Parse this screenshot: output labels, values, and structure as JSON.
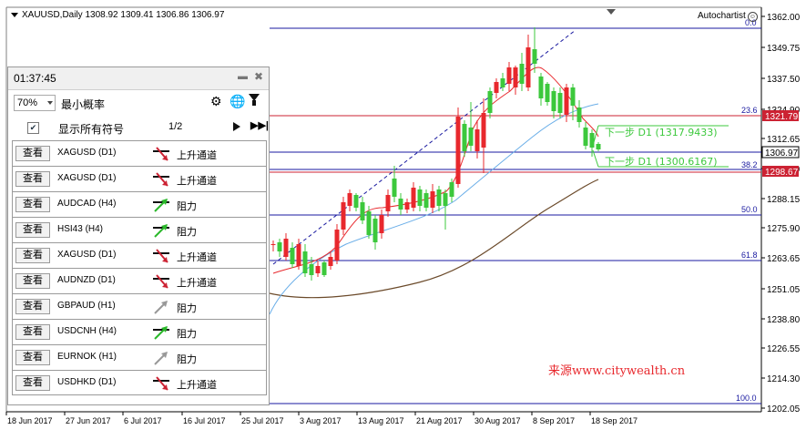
{
  "chart": {
    "symbol_info": "XAUUSD,Daily  1308.92 1309.41 1306.86 1306.97",
    "brand": "Autochartist",
    "watermark": "来源www.citywealth.cn",
    "price_labels": [
      "1362.00",
      "1349.75",
      "1337.50",
      "1324.90",
      "1312.65",
      "1300.40",
      "1288.15",
      "1275.90",
      "1263.65",
      "1251.05",
      "1238.80",
      "1226.55",
      "1214.30",
      "1202.05"
    ],
    "date_labels": [
      "18 Jun 2017",
      "27 Jun 2017",
      "6 Jul 2017",
      "16 Jul 2017",
      "25 Jul 2017",
      "3 Aug 2017",
      "13 Aug 2017",
      "21 Aug 2017",
      "30 Aug 2017",
      "8 Sep 2017",
      "18 Sep 2017"
    ],
    "current_price": "1306.97",
    "level_1321": "1321.79",
    "level_1298": "1298.67",
    "fib_labels": [
      "0.0",
      "23.6",
      "38.2",
      "50.0",
      "61.8",
      "100.0"
    ],
    "forecast_labels": [
      "下一步 D1 (1317.9433)",
      "下一步 D1 (1300.6167)"
    ]
  },
  "panel": {
    "time": "01:37:45",
    "zoom": "70%",
    "min_prob_label": "最小概率",
    "show_all_label": "显示所有符号",
    "page": "1/2",
    "view_label": "查看",
    "items": [
      {
        "symbol": "XAGUSD (D1)",
        "pattern": "上升通道",
        "icon": "channel-down-icon"
      },
      {
        "symbol": "XAGUSD (D1)",
        "pattern": "上升通道",
        "icon": "channel-down-icon"
      },
      {
        "symbol": "AUDCAD (H4)",
        "pattern": "阻力",
        "icon": "resistance-up-icon"
      },
      {
        "symbol": "HSI43 (H4)",
        "pattern": "阻力",
        "icon": "resistance-up-icon"
      },
      {
        "symbol": "XAGUSD (D1)",
        "pattern": "上升通道",
        "icon": "channel-down-icon"
      },
      {
        "symbol": "AUDNZD (D1)",
        "pattern": "上升通道",
        "icon": "channel-down-icon"
      },
      {
        "symbol": "GBPAUD (H1)",
        "pattern": "阻力",
        "icon": "resistance-gray-icon"
      },
      {
        "symbol": "USDCNH (H4)",
        "pattern": "阻力",
        "icon": "resistance-up-icon"
      },
      {
        "symbol": "EURNOK (H1)",
        "pattern": "阻力",
        "icon": "resistance-gray-icon"
      },
      {
        "symbol": "USDHKD (D1)",
        "pattern": "上升通道",
        "icon": "channel-down-icon"
      }
    ]
  },
  "colors": {
    "bull": "#e8282d",
    "bear": "#3cc83c",
    "fib": "#1a1aa0",
    "level": "#cc2233",
    "ma_fast": "#e8282d",
    "ma_mid": "#6aaee8",
    "ma_slow": "#6b4a2a"
  }
}
